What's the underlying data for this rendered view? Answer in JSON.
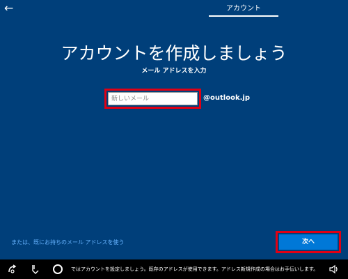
{
  "topbar": {
    "back_glyph": "←",
    "tab_label": "アカウント"
  },
  "main": {
    "title": "アカウントを作成しましょう",
    "subtitle": "メール アドレスを入力",
    "email": {
      "value": "",
      "placeholder": "新しいメール"
    },
    "domain": "@outlook.jp",
    "alt_link": "または、既にお持ちのメール アドレスを使う",
    "next_label": "次へ"
  },
  "taskbar": {
    "narrator_text": "ではアカウントを設定しましょう。既存のアドレスが使用できます。アドレス新規作成の場合はお手伝いします。",
    "icons": [
      "ease-of-access-icon",
      "keyboard-icon",
      "cortana-icon",
      "volume-icon"
    ]
  },
  "colors": {
    "background": "#003f7a",
    "highlight": "#e00014",
    "button": "#0078d7",
    "link": "#66b3ff"
  }
}
